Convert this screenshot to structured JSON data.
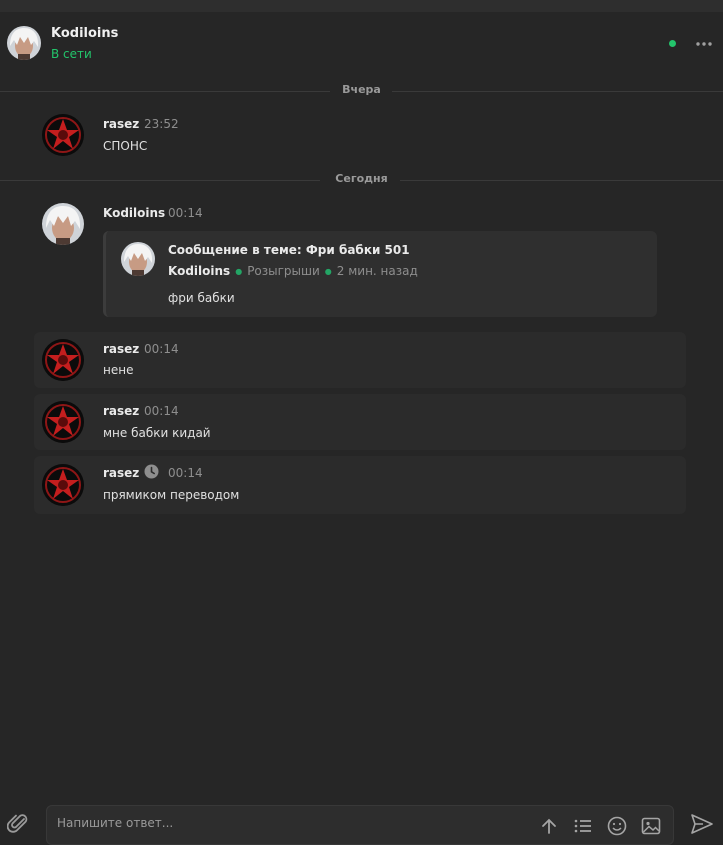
{
  "header": {
    "name": "Kodiloins",
    "status": "В сети",
    "more_icon": "more-horizontal-icon",
    "status_color": "#23c46b"
  },
  "dividers": {
    "yesterday": "Вчера",
    "today": "Сегодня"
  },
  "messages": [
    {
      "author": "rasez",
      "time": "23:52",
      "text": "СПОНС"
    },
    {
      "author": "Kodiloins",
      "time": "00:14",
      "quote": {
        "title": "Сообщение в теме: Фри бабки 501",
        "author": "Kodiloins",
        "category": "Розыгрыши",
        "ago": "2 мин. назад",
        "body": "фри бабки"
      }
    },
    {
      "author": "rasez",
      "time": "00:14",
      "text": "нене"
    },
    {
      "author": "rasez",
      "time": "00:14",
      "text": "мне бабки кидай"
    },
    {
      "author": "rasez",
      "time": "00:14",
      "text": "прямиком переводом",
      "pending_icon": "clock-icon"
    }
  ],
  "composer": {
    "placeholder": "Напишите ответ...",
    "icons": [
      "paperclip-icon",
      "arrow-up-icon",
      "list-icon",
      "smile-icon",
      "image-icon",
      "send-icon"
    ]
  }
}
